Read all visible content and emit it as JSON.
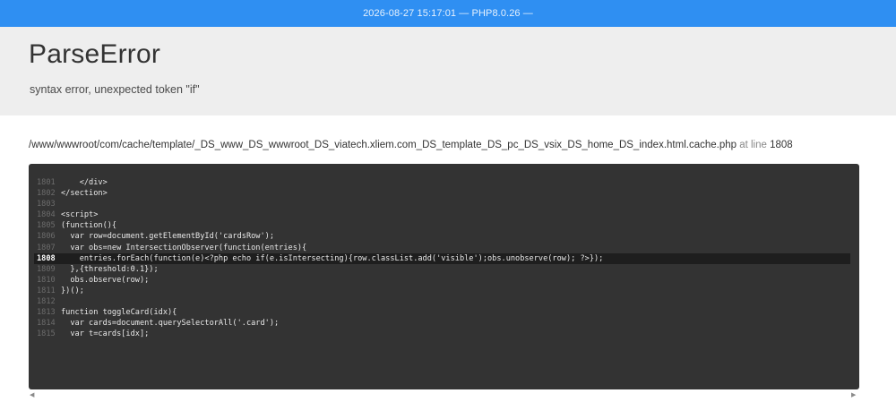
{
  "topbar": {
    "info": "2026-08-27 15:17:01 — PHP8.0.26 —"
  },
  "error": {
    "type": "ParseError",
    "message": "syntax error, unexpected token \"if\""
  },
  "location": {
    "path": "/www/wwwroot/com/cache/template/_DS_www_DS_wwwroot_DS_viatech.xliem.com_DS_template_DS_pc_DS_vsix_DS_home_DS_index.html.cache.php",
    "at_line_label": "at line",
    "line": "1808"
  },
  "code": {
    "lines": [
      {
        "num": "1801",
        "src": "    </div>"
      },
      {
        "num": "1802",
        "src": "</section>"
      },
      {
        "num": "1803",
        "src": ""
      },
      {
        "num": "1804",
        "src": "<script>"
      },
      {
        "num": "1805",
        "src": "(function(){"
      },
      {
        "num": "1806",
        "src": "  var row=document.getElementById('cardsRow');"
      },
      {
        "num": "1807",
        "src": "  var obs=new IntersectionObserver(function(entries){"
      },
      {
        "num": "1808",
        "src": "    entries.forEach(function(e)<?php echo if(e.isIntersecting){row.classList.add('visible');obs.unobserve(row); ?>});"
      },
      {
        "num": "1809",
        "src": "  },{threshold:0.1});"
      },
      {
        "num": "1810",
        "src": "  obs.observe(row);"
      },
      {
        "num": "1811",
        "src": "})();"
      },
      {
        "num": "1812",
        "src": ""
      },
      {
        "num": "1813",
        "src": "function toggleCard(idx){"
      },
      {
        "num": "1814",
        "src": "  var cards=document.querySelectorAll('.card');"
      },
      {
        "num": "1815",
        "src": "  var t=cards[idx];"
      }
    ],
    "current_line": "1808"
  },
  "icons": {
    "scroll_left": "triangle-left-icon",
    "scroll_right": "triangle-right-icon"
  }
}
